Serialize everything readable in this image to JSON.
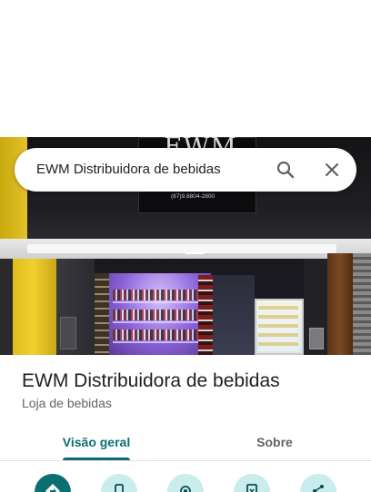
{
  "search": {
    "query": "EWM Distribuidora de bebidas"
  },
  "photo": {
    "sign_text": "EWM",
    "sign_phone": "(87)9.8804-2800"
  },
  "place": {
    "title": "EWM Distribuidora de bebidas",
    "category": "Loja de bebidas"
  },
  "tabs": [
    {
      "label": "Visão geral",
      "selected": true
    },
    {
      "label": "Sobre",
      "selected": false
    }
  ],
  "actions": [
    {
      "icon": "directions-icon"
    },
    {
      "icon": "phone-icon"
    },
    {
      "icon": "location-pin-icon"
    },
    {
      "icon": "save-icon"
    },
    {
      "icon": "share-icon"
    }
  ],
  "colors": {
    "accent": "#0b6e73",
    "action_bg": "#c9ecec",
    "text_primary": "#202124",
    "text_secondary": "#5f6368"
  }
}
